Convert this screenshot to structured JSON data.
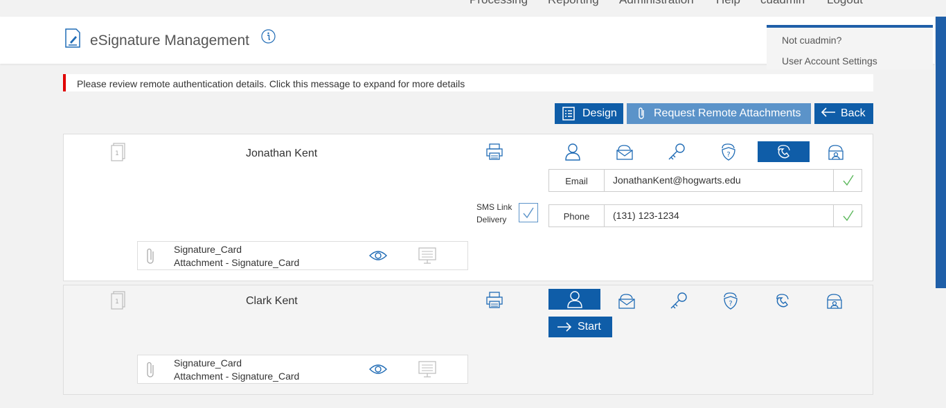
{
  "topnav": {
    "items": [
      "Processing",
      "Reporting",
      "Administration",
      "Help",
      "cuadmin",
      "Logout"
    ]
  },
  "header": {
    "title": "eSignature Management"
  },
  "user_menu": {
    "not_user": "Not cuadmin?",
    "settings": "User Account Settings"
  },
  "alert": {
    "message": "Please review remote authentication details. Click this message to expand for more details"
  },
  "toolbar": {
    "design_label": "Design",
    "request_label": "Request Remote Attachments",
    "back_label": "Back"
  },
  "signers": [
    {
      "name": "Jonathan Kent",
      "active_method": "phone",
      "email_label": "Email",
      "email_value": "JonathanKent@hogwarts.edu",
      "sms_label_line1": "SMS Link",
      "sms_label_line2": "Delivery",
      "phone_label": "Phone",
      "phone_value": "(131) 123-1234",
      "attachment": {
        "name": "Signature_Card",
        "description": "Attachment - Signature_Card"
      }
    },
    {
      "name": "Clark Kent",
      "active_method": "in-person",
      "start_label": "Start",
      "attachment": {
        "name": "Signature_Card",
        "description": "Attachment - Signature_Card"
      }
    }
  ],
  "colors": {
    "primary": "#0f5da8",
    "primary_light": "#5b93c9",
    "alert_red": "#e00000",
    "check_green": "#5cb85c",
    "icon_blue": "#1f6bb5"
  }
}
